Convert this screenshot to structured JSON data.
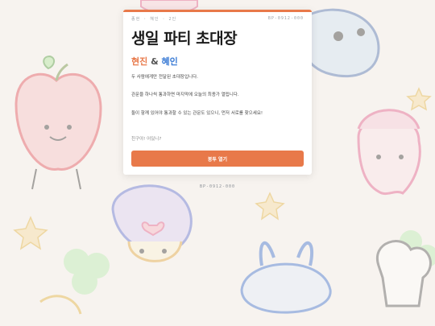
{
  "card": {
    "top_left": "종현 · 혜인 · 2인",
    "top_right": "BP-0912-000",
    "title": "생일 파티 초대장",
    "name_1": "현진",
    "amp": "&",
    "name_2": "혜인",
    "paragraphs": [
      "두 사람에게만 전달된 초대장입니다.",
      "관문을 하나씩 통과하면 마지막에 오늘의 최종가 열립니다.",
      "둘이 함께 있어야 통과할 수 있는 관문도 있으니, 먼저 서로를 찾으세요!"
    ],
    "question": "친구야! 어딨니?",
    "button_label": "봉투 열기"
  },
  "footer_code": "BP-0912-000",
  "colors": {
    "accent": "#e8794a",
    "name_2": "#3a7bd5",
    "background": "#f7f3ef"
  }
}
